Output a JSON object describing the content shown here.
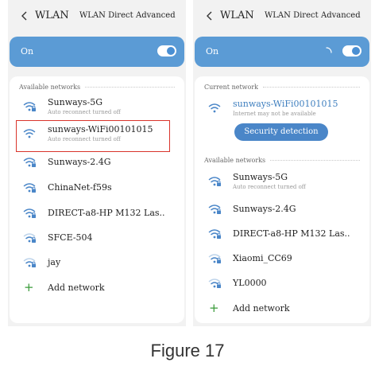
{
  "left_screen": {
    "header": {
      "title": "WLAN",
      "direct_label": "WLAN Direct",
      "advanced_label": "Advanced"
    },
    "toggle": {
      "label": "On",
      "state": "on"
    },
    "available_label": "Available networks",
    "networks": [
      {
        "name": "Sunways-5G",
        "sub": "Auto reconnect turned off",
        "icon": "wifi-lock-icon",
        "signal": 3
      },
      {
        "name": "sunways-WiFi00101015",
        "sub": "Auto reconnect turned off",
        "icon": "wifi-icon",
        "signal": 3,
        "highlighted": true
      },
      {
        "name": "Sunways-2.4G",
        "sub": "",
        "icon": "wifi-lock-icon",
        "signal": 3
      },
      {
        "name": "ChinaNet-f59s",
        "sub": "",
        "icon": "wifi-lock-icon",
        "signal": 3
      },
      {
        "name": "DIRECT-a8-HP M132 Las..",
        "sub": "",
        "icon": "wifi-lock-icon",
        "signal": 3
      },
      {
        "name": "SFCE-504",
        "sub": "",
        "icon": "wifi-lock-icon",
        "signal": 2
      },
      {
        "name": "jay",
        "sub": "",
        "icon": "wifi-lock-icon",
        "signal": 2
      }
    ],
    "add_network": "Add network"
  },
  "right_screen": {
    "header": {
      "title": "WLAN",
      "direct_label": "WLAN Direct",
      "advanced_label": "Advanced"
    },
    "toggle": {
      "label": "On",
      "state": "on"
    },
    "current_label": "Current network",
    "current": {
      "name": "sunways-WiFi00101015",
      "sub": "Internet may not be available",
      "icon": "wifi-icon"
    },
    "security_button": "Security detection",
    "available_label": "Available networks",
    "networks": [
      {
        "name": "Sunways-5G",
        "sub": "Auto reconnect turned off",
        "icon": "wifi-lock-icon",
        "signal": 3
      },
      {
        "name": "Sunways-2.4G",
        "sub": "",
        "icon": "wifi-lock-icon",
        "signal": 3
      },
      {
        "name": "DIRECT-a8-HP M132 Las..",
        "sub": "",
        "icon": "wifi-lock-icon",
        "signal": 3
      },
      {
        "name": "Xiaomi_CC69",
        "sub": "",
        "icon": "wifi-lock-icon",
        "signal": 2
      },
      {
        "name": "YL0000",
        "sub": "",
        "icon": "wifi-lock-icon",
        "signal": 2
      }
    ],
    "add_network": "Add network"
  },
  "colors": {
    "accent": "#5b9bd5",
    "highlight_border": "#d9342b",
    "add_green": "#3a9b3a",
    "link_blue": "#3f7fbf"
  },
  "caption": "Figure 17"
}
